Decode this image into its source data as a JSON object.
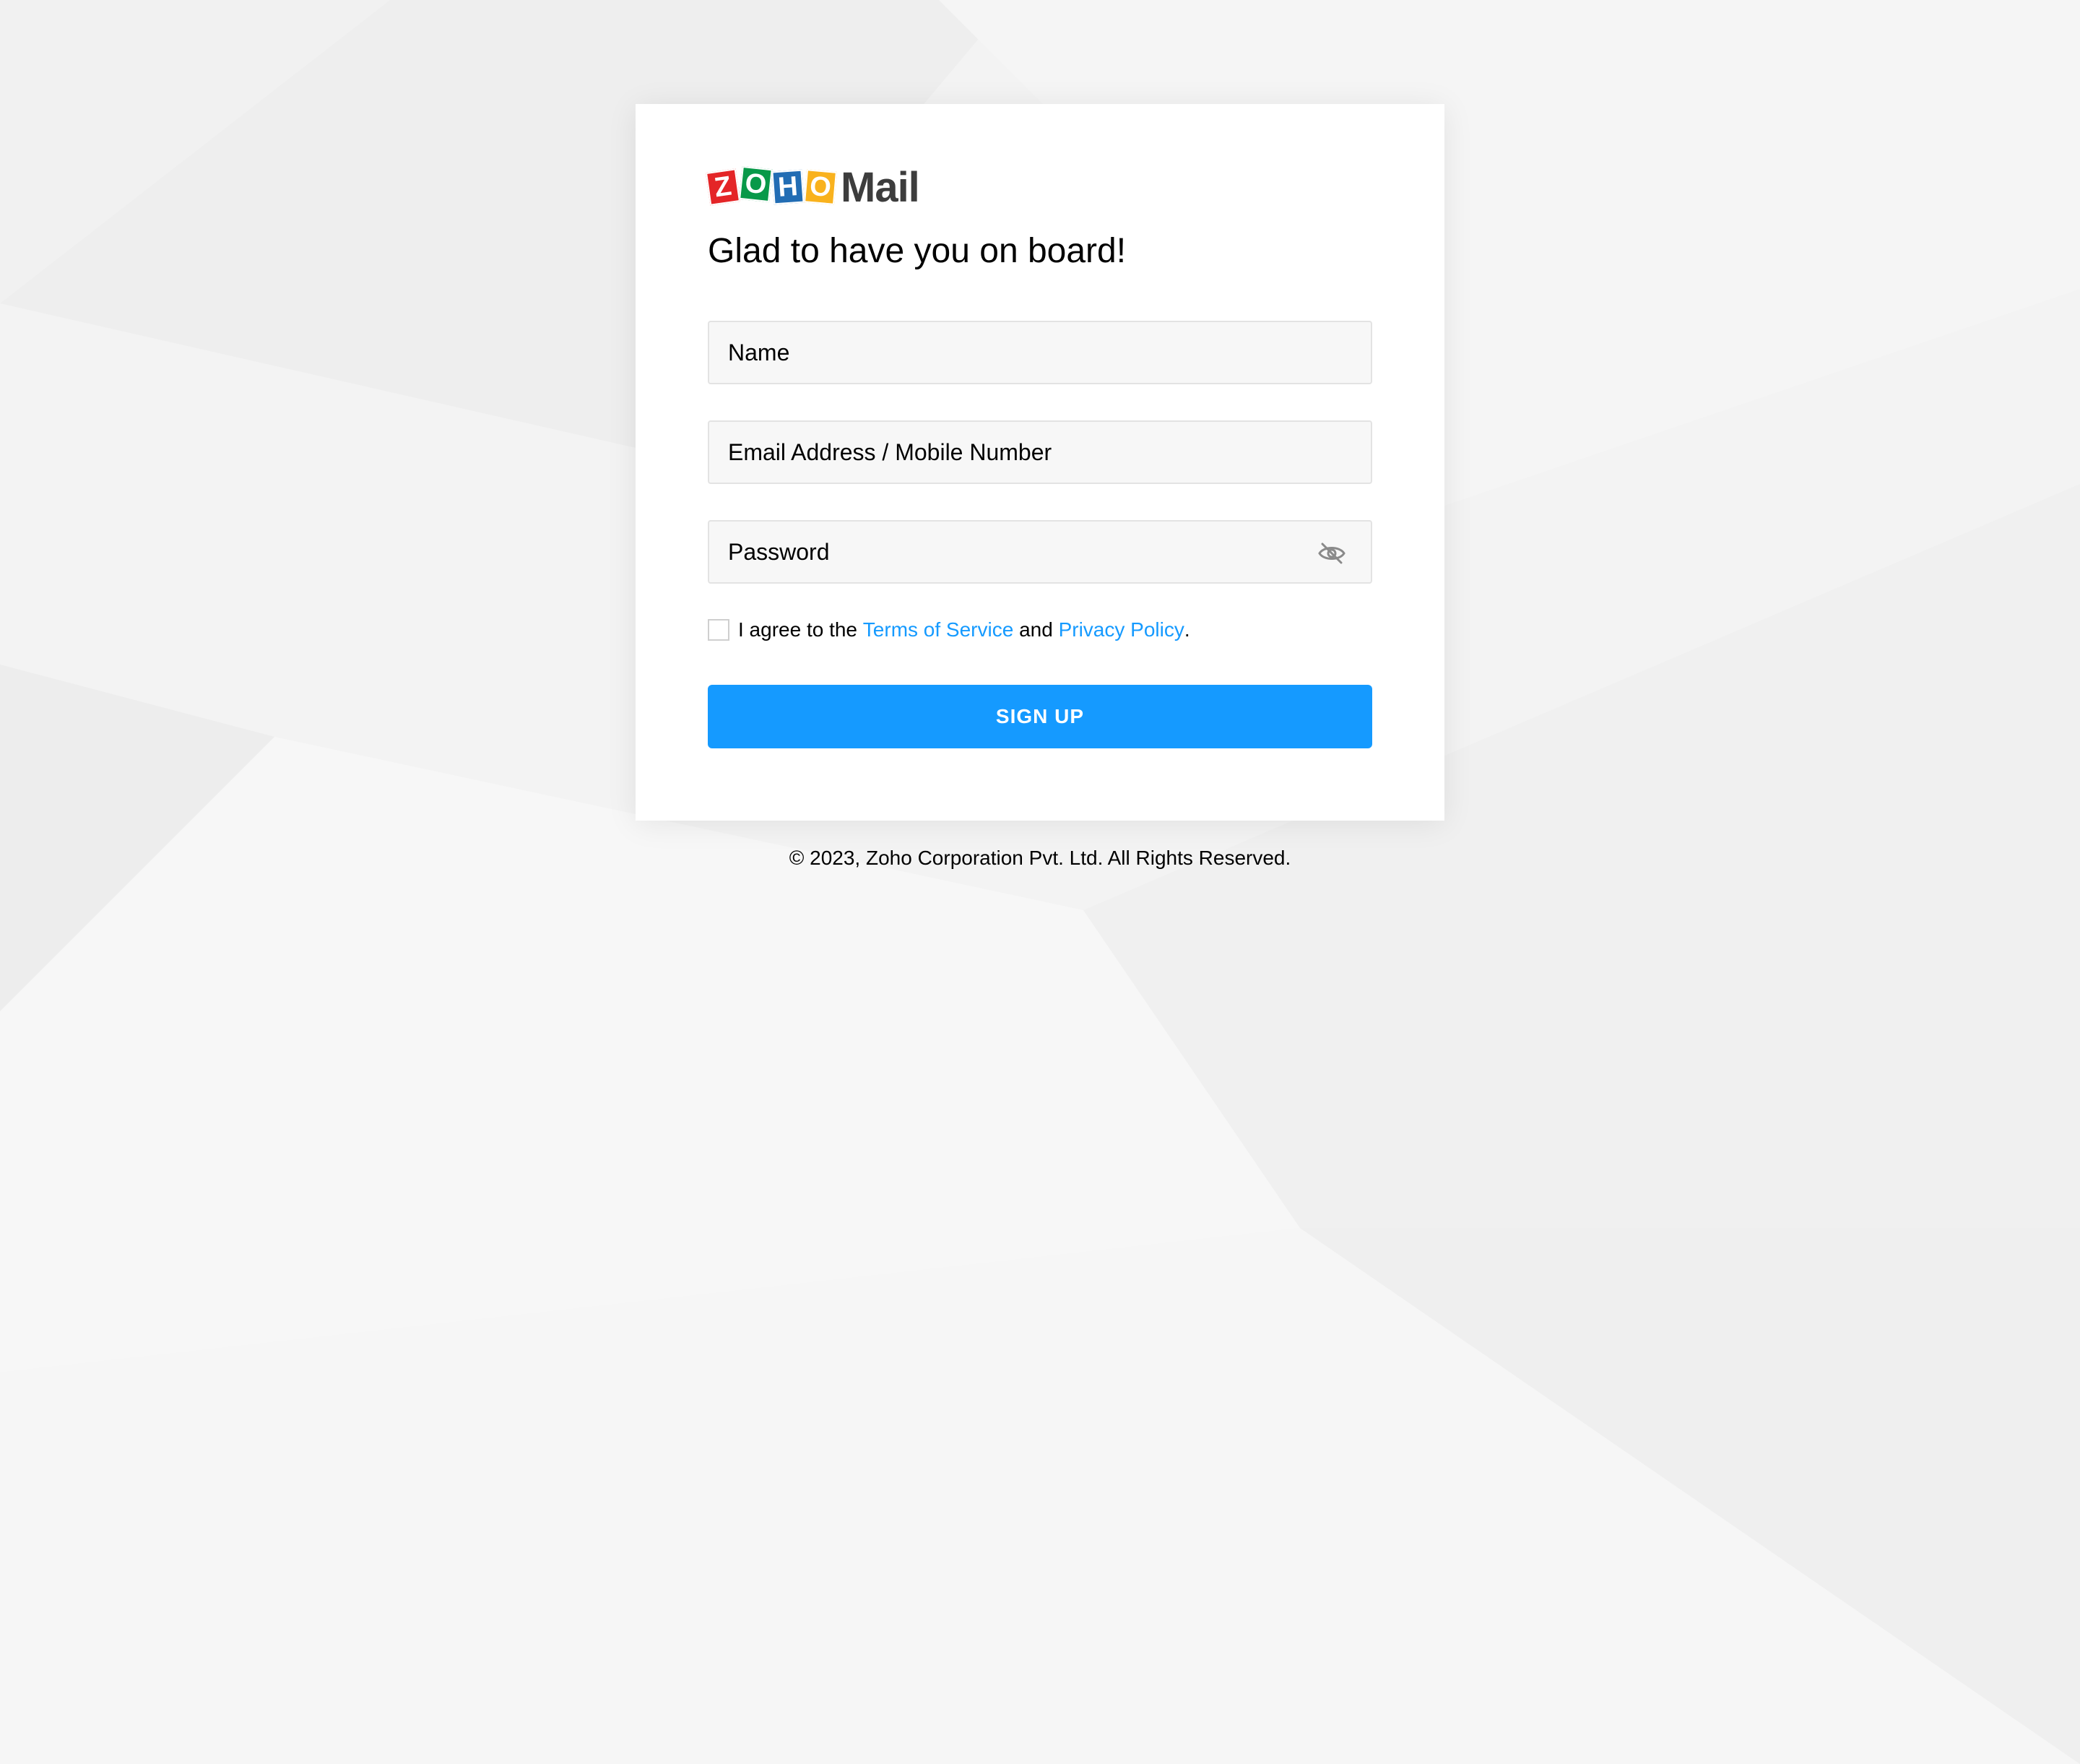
{
  "logo": {
    "tiles": [
      "Z",
      "O",
      "H",
      "O"
    ],
    "product": "Mail"
  },
  "title": "Glad to have you on board!",
  "form": {
    "name_placeholder": "Name",
    "email_placeholder": "Email Address / Mobile Number",
    "password_placeholder": "Password",
    "password_toggle_icon": "eye-off-icon",
    "agree": {
      "prefix": "I agree to the",
      "terms_link": "Terms of Service",
      "and": "and",
      "privacy_link": "Privacy Policy",
      "suffix": "."
    },
    "signup_label": "SIGN UP"
  },
  "footer": {
    "copyright": "© 2023, Zoho Corporation Pvt. Ltd. All Rights Reserved."
  },
  "colors": {
    "accent": "#159aff",
    "background": "#f3f3f3",
    "card": "#ffffff",
    "zoho_red": "#e42527",
    "zoho_green": "#089949",
    "zoho_blue": "#226db4",
    "zoho_yellow": "#f9b21d"
  }
}
